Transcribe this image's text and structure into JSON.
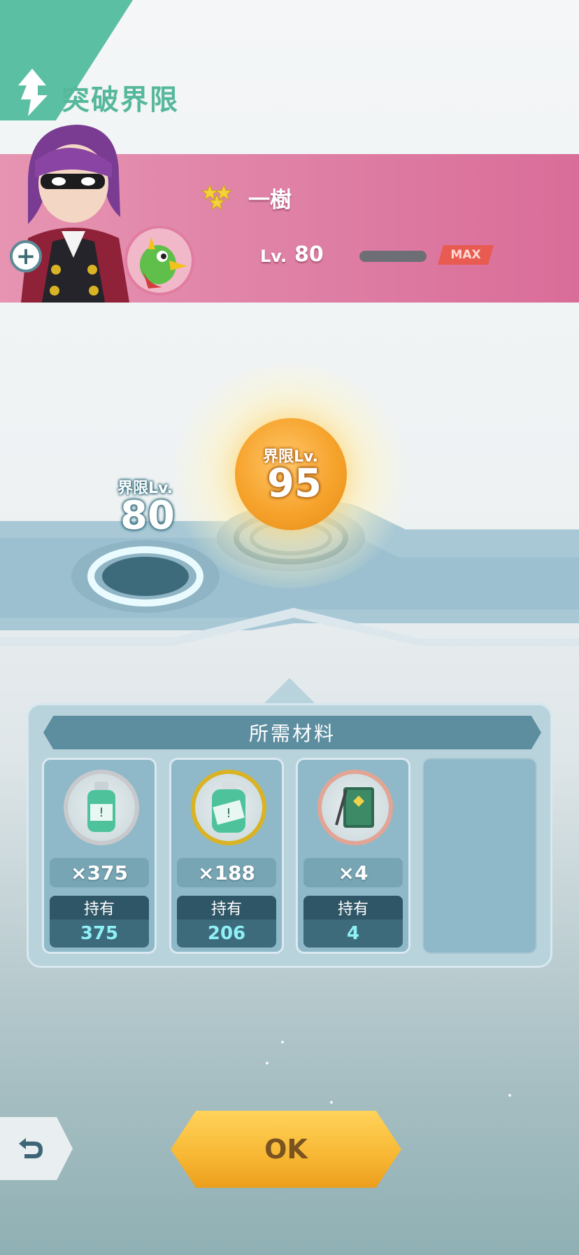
{
  "header": {
    "title": "突破界限"
  },
  "trainer": {
    "name": "一樹",
    "stars": 3,
    "level_label": "Lv.",
    "level": "80",
    "max_badge": "MAX",
    "exp_fraction": 1.0
  },
  "limit": {
    "current_label": "界限Lv.",
    "current_value": "80",
    "next_label": "界限Lv.",
    "next_value": "95"
  },
  "materials": {
    "title": "所需材料",
    "items": [
      {
        "icon": "small-drink-bottle-icon",
        "quantity": "×375",
        "owned_label": "持有",
        "owned": "375",
        "ring_color": "#c7c9cc"
      },
      {
        "icon": "large-drink-bottle-icon",
        "quantity": "×188",
        "owned_label": "持有",
        "owned": "206",
        "ring_color": "#d9b324"
      },
      {
        "icon": "notebook-icon",
        "quantity": "×4",
        "owned_label": "持有",
        "owned": "4",
        "ring_color": "#e2a595"
      }
    ]
  },
  "buttons": {
    "ok": "OK"
  },
  "colors": {
    "accent": "#5bbfa4",
    "band": "#d96d99",
    "ok": "#f7b733",
    "max": "#e85b50"
  }
}
